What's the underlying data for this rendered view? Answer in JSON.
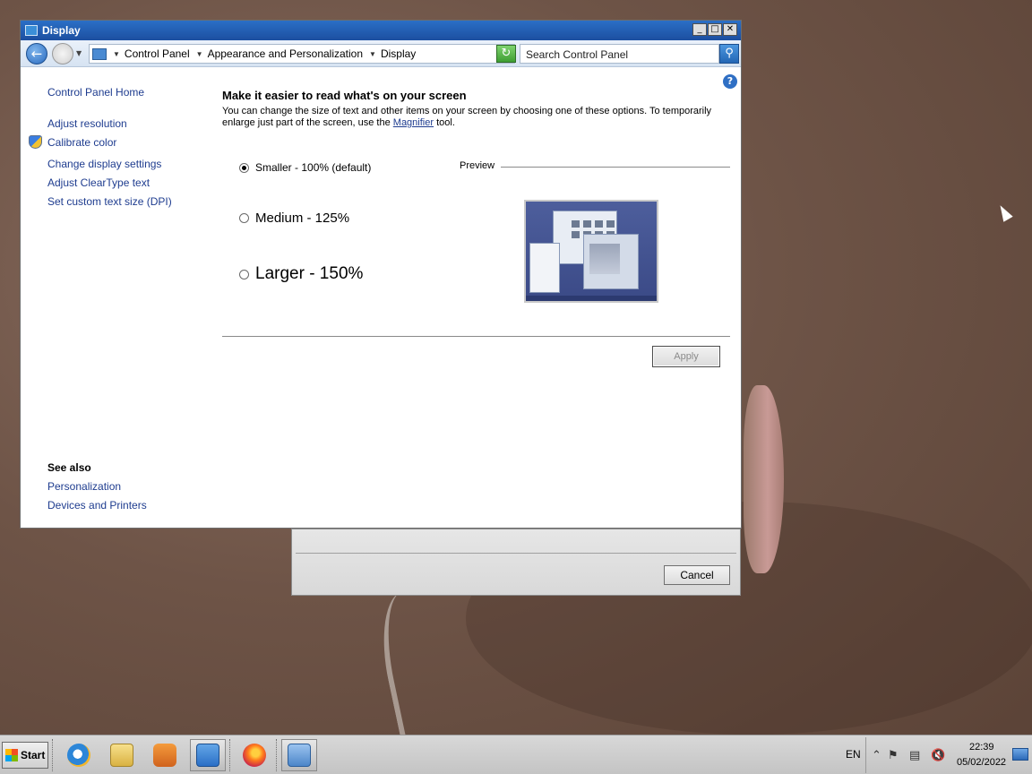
{
  "window": {
    "title": "Display",
    "controls": {
      "minimize": "_",
      "maximize": "□",
      "close": "✕"
    }
  },
  "address": {
    "crumbs": [
      "Control Panel",
      "Appearance and Personalization",
      "Display"
    ],
    "search_placeholder": "Search Control Panel"
  },
  "sidebar": {
    "home": "Control Panel Home",
    "links": [
      "Adjust resolution",
      "Calibrate color",
      "Change display settings",
      "Adjust ClearType text",
      "Set custom text size (DPI)"
    ],
    "see_also_title": "See also",
    "see_also": [
      "Personalization",
      "Devices and Printers"
    ]
  },
  "main": {
    "heading": "Make it easier to read what's on your screen",
    "desc_before": "You can change the size of text and other items on your screen by choosing one of these options. To temporarily enlarge just part of the screen, use the ",
    "desc_link": "Magnifier",
    "desc_after": " tool.",
    "options": [
      {
        "label": "Smaller - 100% (default)",
        "selected": true
      },
      {
        "label": "Medium - 125%",
        "selected": false
      },
      {
        "label": "Larger - 150%",
        "selected": false
      }
    ],
    "preview_label": "Preview",
    "apply_label": "Apply"
  },
  "back_dialog": {
    "cancel_label": "Cancel"
  },
  "taskbar": {
    "start_label": "Start",
    "language": "EN",
    "time": "22:39",
    "date": "05/02/2022"
  },
  "colors": {
    "title_bar": "#1c4fa0",
    "link": "#1e3c8f"
  }
}
